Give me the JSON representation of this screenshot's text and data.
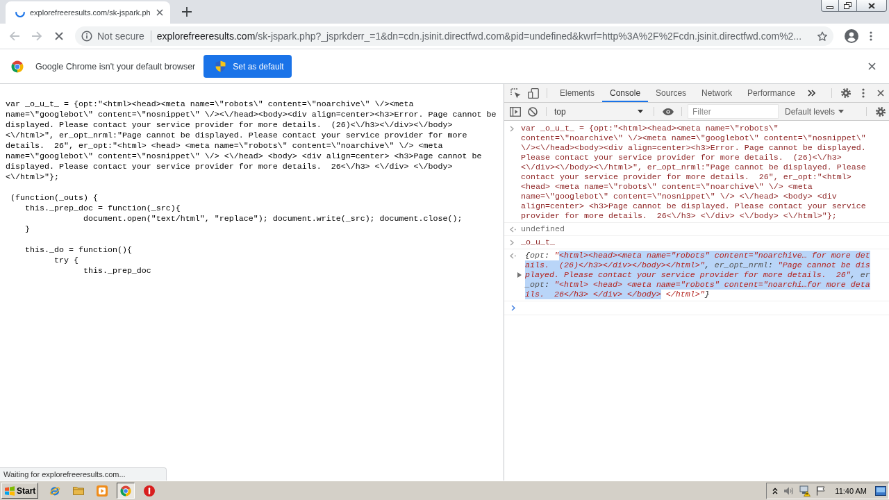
{
  "browser": {
    "tabs": [
      {
        "title": "explorefreeresults.com/sk-jspark.ph",
        "selected": true,
        "loading": true
      }
    ],
    "nav_buttons": [
      {
        "kind": "back",
        "disabled": true
      },
      {
        "kind": "forward",
        "disabled": true
      }
    ],
    "address_bar": {
      "security_label": "Not secure",
      "host": "explorefreeresults.com",
      "path": "/sk-jspark.php?_jsprkderr_=1&dn=cdn.jsinit.directfwd.com&pid=undefined&kwrf=http%3A%2F%2Fcdn.jsinit.directfwd.com%2..."
    }
  },
  "infobar": {
    "message": "Google Chrome isn't your default browser",
    "button": "Set as default"
  },
  "page": {
    "code_blocks": [
      [
        "var _o_u_t_ = {opt:\"<html><head><meta name=\\\"robots\\\" content=\\\"noarchive\\\" \\/><meta",
        "name=\\\"googlebot\\\" content=\\\"nosnippet\\\" \\/><\\/head><body><div align=center><h3>Error. Page cannot be",
        "displayed. Please contact your service provider for more details.  (26)<\\/h3><\\/div><\\/body>",
        "<\\/html>\", er_opt_nrml:\"Page cannot be displayed. Please contact your service provider for more",
        "details.  26\", er_opt:\"<html> <head> <meta name=\\\"robots\\\" content=\\\"noarchive\\\" \\/> <meta",
        "name=\\\"googlebot\\\" content=\\\"nosnippet\\\" \\/> <\\/head> <body> <div align=center> <h3>Page cannot be",
        "displayed. Please contact your service provider for more details.  26<\\/h3> <\\/div> <\\/body>",
        "<\\/html>\"};"
      ],
      [
        " (function(_outs) {",
        "    this._prep_doc = function(_src){",
        "                document.open(\"text/html\", \"replace\"); document.write(_src); document.close();",
        "    }"
      ],
      [
        "    this._do = function(){",
        "          try {",
        "                this._prep_doc"
      ]
    ]
  },
  "status_bubble": "Waiting for explorefreeresults.com...",
  "devtools": {
    "tabs": [
      {
        "label": "Elements",
        "selected": false
      },
      {
        "label": "Console",
        "selected": true
      },
      {
        "label": "Sources",
        "selected": false
      },
      {
        "label": "Network",
        "selected": false
      },
      {
        "label": "Performance",
        "selected": false
      }
    ],
    "console_toolbar": {
      "context": "top",
      "filter_placeholder": "Filter",
      "levels": "Default levels"
    },
    "messages": [
      {
        "kind": "input",
        "lines": [
          "var _o_u_t_ = {opt:\"<html><head><meta name=\\\"robots\\\"",
          "content=\\\"noarchive\\\" \\/><meta name=\\\"googlebot\\\" content=\\\"nosnippet\\\"",
          "\\/><\\/head><body><div align=center><h3>Error. Page cannot be displayed.",
          "Please contact your service provider for more details.  (26)<\\/h3>",
          "<\\/div><\\/body><\\/html>\", er_opt_nrml:\"Page cannot be displayed. Please",
          "contact your service provider for more details.  26\", er_opt:\"<html>",
          "<head> <meta name=\\\"robots\\\" content=\\\"noarchive\\\" \\/> <meta",
          "name=\\\"googlebot\\\" content=\\\"nosnippet\\\" \\/> <\\/head> <body> <div",
          "align=center> <h3>Page cannot be displayed. Please contact your service",
          "provider for more details.  26<\\/h3> <\\/div> <\\/body> <\\/html>\"};"
        ]
      },
      {
        "kind": "return",
        "text": "undefined"
      },
      {
        "kind": "input",
        "lines": [
          "_o_u_t_"
        ]
      },
      {
        "kind": "object",
        "expanded": false,
        "lines": [
          [
            {
              "kind": "punct",
              "text": "{",
              "selected": false
            },
            {
              "kind": "key",
              "text": "opt",
              "selected": false
            },
            {
              "kind": "punct",
              "text": ": ",
              "selected": false
            },
            {
              "kind": "string",
              "text": "\"",
              "selected": false
            },
            {
              "kind": "string",
              "text": "<html><head><meta name=\"robots\" content=\"noarchive… for more det",
              "selected": true
            }
          ],
          [
            {
              "kind": "string",
              "text": "ails.  (26)</h3></div></body></html>\"",
              "selected": true
            },
            {
              "kind": "punct",
              "text": ", ",
              "selected": true
            },
            {
              "kind": "key",
              "text": "er_opt_nrml",
              "selected": true
            },
            {
              "kind": "punct",
              "text": ": ",
              "selected": true
            },
            {
              "kind": "string",
              "text": "\"Page cannot be dis",
              "selected": true
            }
          ],
          [
            {
              "kind": "string",
              "text": "played. Please contact your service provider for more details.  26\"",
              "selected": true
            },
            {
              "kind": "punct",
              "text": ", ",
              "selected": true
            },
            {
              "kind": "key",
              "text": "er",
              "selected": true
            }
          ],
          [
            {
              "kind": "key",
              "text": "_opt",
              "selected": true
            },
            {
              "kind": "punct",
              "text": ": ",
              "selected": true
            },
            {
              "kind": "string",
              "text": "\"<html> <head> <meta name=\"robots\" content=\"noarchi…for more deta",
              "selected": true
            }
          ],
          [
            {
              "kind": "string",
              "text": "ils.  26</h3> </div> </body>",
              "selected": true
            },
            {
              "kind": "string",
              "text": " </html>\"",
              "selected": false
            },
            {
              "kind": "punct",
              "text": "}",
              "selected": false
            }
          ]
        ]
      }
    ]
  },
  "taskbar": {
    "start": "Start",
    "apps": [
      {
        "kind": "ie",
        "selected": false
      },
      {
        "kind": "folder",
        "selected": false
      },
      {
        "kind": "media",
        "selected": false
      },
      {
        "kind": "chrome",
        "selected": true
      },
      {
        "kind": "stop",
        "selected": false
      }
    ],
    "clock": "11:40 AM"
  }
}
